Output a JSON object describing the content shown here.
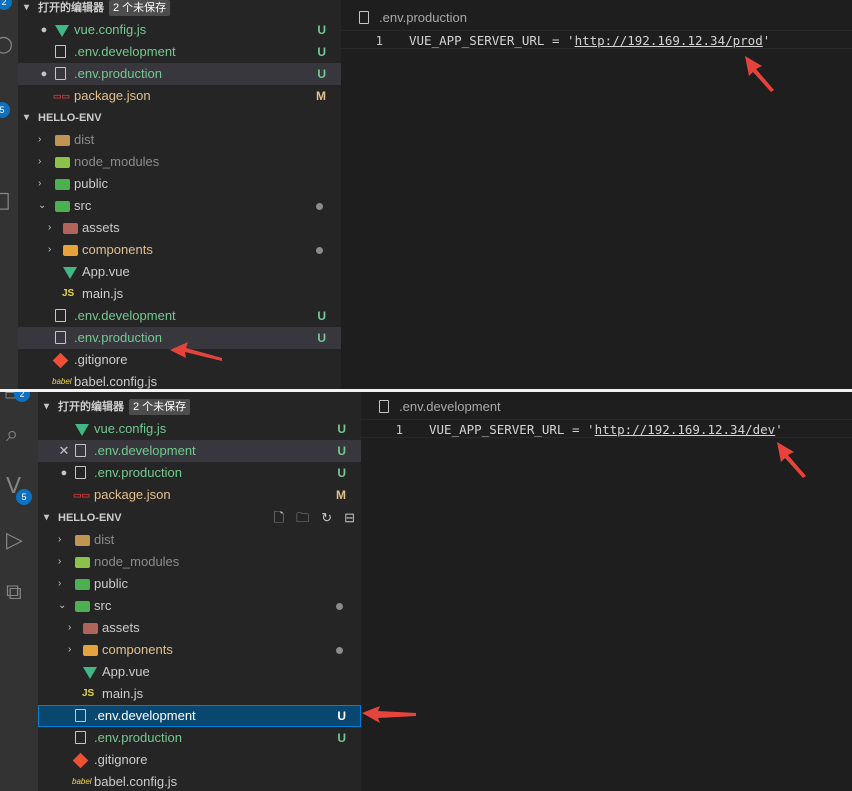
{
  "colors": {
    "activity_bar": "#333333",
    "sidebar": "#252526",
    "editor": "#1e1e1e",
    "untracked": "#73c991",
    "modified": "#e2c08d",
    "selection": "#094771",
    "arrow": "#e6443a"
  },
  "top": {
    "activity": {
      "badge_top": "2",
      "badge_scm": "5"
    },
    "open_editors": {
      "title": "打开的编辑器",
      "badge": "2 个未保存",
      "items": [
        {
          "name": "vue.config.js",
          "icon": "vue-icon",
          "status": "U",
          "dirty": true
        },
        {
          "name": ".env.development",
          "icon": "file-icon",
          "status": "U",
          "dirty": false
        },
        {
          "name": ".env.production",
          "icon": "file-icon",
          "status": "U",
          "dirty": true
        },
        {
          "name": "package.json",
          "icon": "package-icon",
          "status": "M",
          "dirty": false
        }
      ]
    },
    "explorer": {
      "title": "HELLO-ENV",
      "items": [
        {
          "name": "dist",
          "icon": "folder-icon"
        },
        {
          "name": "node_modules",
          "icon": "folder-icon"
        },
        {
          "name": "public",
          "icon": "folder-icon"
        },
        {
          "name": "src",
          "icon": "folder-icon"
        },
        {
          "name": "assets",
          "icon": "folder-icon"
        },
        {
          "name": "components",
          "icon": "folder-icon"
        },
        {
          "name": "App.vue",
          "icon": "vue-icon"
        },
        {
          "name": "main.js",
          "icon": "js-icon"
        },
        {
          "name": ".env.development",
          "icon": "file-icon",
          "status": "U"
        },
        {
          "name": ".env.production",
          "icon": "file-icon",
          "status": "U"
        },
        {
          "name": ".gitignore",
          "icon": "git-icon"
        },
        {
          "name": "babel.config.js",
          "icon": "babel-icon"
        }
      ]
    },
    "editor": {
      "tab": ".env.production",
      "line_number": "1",
      "code_before": "VUE_APP_SERVER_URL = '",
      "code_url": "http://192.169.12.34/prod",
      "code_after": "'"
    }
  },
  "bottom": {
    "activity": {
      "badge_top": "2",
      "badge_scm": "5"
    },
    "open_editors": {
      "title": "打开的编辑器",
      "badge": "2 个未保存",
      "items": [
        {
          "name": "vue.config.js",
          "icon": "vue-icon",
          "status": "U",
          "dirty": false
        },
        {
          "name": ".env.development",
          "icon": "file-icon",
          "status": "U",
          "dirty": false
        },
        {
          "name": ".env.production",
          "icon": "file-icon",
          "status": "U",
          "dirty": true
        },
        {
          "name": "package.json",
          "icon": "package-icon",
          "status": "M",
          "dirty": false
        }
      ]
    },
    "explorer": {
      "title": "HELLO-ENV",
      "items": [
        {
          "name": "dist",
          "icon": "folder-icon"
        },
        {
          "name": "node_modules",
          "icon": "folder-icon"
        },
        {
          "name": "public",
          "icon": "folder-icon"
        },
        {
          "name": "src",
          "icon": "folder-icon"
        },
        {
          "name": "assets",
          "icon": "folder-icon"
        },
        {
          "name": "components",
          "icon": "folder-icon"
        },
        {
          "name": "App.vue",
          "icon": "vue-icon"
        },
        {
          "name": "main.js",
          "icon": "js-icon"
        },
        {
          "name": ".env.development",
          "icon": "file-icon",
          "status": "U"
        },
        {
          "name": ".env.production",
          "icon": "file-icon",
          "status": "U"
        },
        {
          "name": ".gitignore",
          "icon": "git-icon"
        },
        {
          "name": "babel.config.js",
          "icon": "babel-icon"
        }
      ]
    },
    "editor": {
      "tab": ".env.development",
      "line_number": "1",
      "code_before": "VUE_APP_SERVER_URL = '",
      "code_url": "http://192.169.12.34/dev",
      "code_after": "'"
    }
  }
}
